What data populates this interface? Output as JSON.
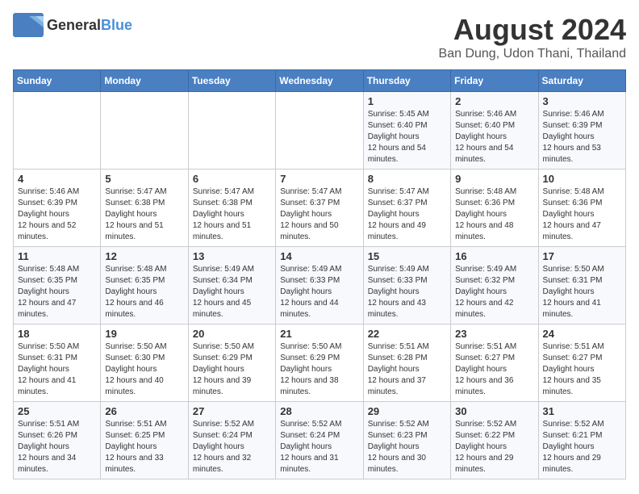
{
  "header": {
    "logo_general": "General",
    "logo_blue": "Blue",
    "month_year": "August 2024",
    "location": "Ban Dung, Udon Thani, Thailand"
  },
  "weekdays": [
    "Sunday",
    "Monday",
    "Tuesday",
    "Wednesday",
    "Thursday",
    "Friday",
    "Saturday"
  ],
  "weeks": [
    [
      {
        "day": "",
        "sunrise": "",
        "sunset": "",
        "daylight": ""
      },
      {
        "day": "",
        "sunrise": "",
        "sunset": "",
        "daylight": ""
      },
      {
        "day": "",
        "sunrise": "",
        "sunset": "",
        "daylight": ""
      },
      {
        "day": "",
        "sunrise": "",
        "sunset": "",
        "daylight": ""
      },
      {
        "day": "1",
        "sunrise": "5:45 AM",
        "sunset": "6:40 PM",
        "daylight": "12 hours and 54 minutes."
      },
      {
        "day": "2",
        "sunrise": "5:46 AM",
        "sunset": "6:40 PM",
        "daylight": "12 hours and 54 minutes."
      },
      {
        "day": "3",
        "sunrise": "5:46 AM",
        "sunset": "6:39 PM",
        "daylight": "12 hours and 53 minutes."
      }
    ],
    [
      {
        "day": "4",
        "sunrise": "5:46 AM",
        "sunset": "6:39 PM",
        "daylight": "12 hours and 52 minutes."
      },
      {
        "day": "5",
        "sunrise": "5:47 AM",
        "sunset": "6:38 PM",
        "daylight": "12 hours and 51 minutes."
      },
      {
        "day": "6",
        "sunrise": "5:47 AM",
        "sunset": "6:38 PM",
        "daylight": "12 hours and 51 minutes."
      },
      {
        "day": "7",
        "sunrise": "5:47 AM",
        "sunset": "6:37 PM",
        "daylight": "12 hours and 50 minutes."
      },
      {
        "day": "8",
        "sunrise": "5:47 AM",
        "sunset": "6:37 PM",
        "daylight": "12 hours and 49 minutes."
      },
      {
        "day": "9",
        "sunrise": "5:48 AM",
        "sunset": "6:36 PM",
        "daylight": "12 hours and 48 minutes."
      },
      {
        "day": "10",
        "sunrise": "5:48 AM",
        "sunset": "6:36 PM",
        "daylight": "12 hours and 47 minutes."
      }
    ],
    [
      {
        "day": "11",
        "sunrise": "5:48 AM",
        "sunset": "6:35 PM",
        "daylight": "12 hours and 47 minutes."
      },
      {
        "day": "12",
        "sunrise": "5:48 AM",
        "sunset": "6:35 PM",
        "daylight": "12 hours and 46 minutes."
      },
      {
        "day": "13",
        "sunrise": "5:49 AM",
        "sunset": "6:34 PM",
        "daylight": "12 hours and 45 minutes."
      },
      {
        "day": "14",
        "sunrise": "5:49 AM",
        "sunset": "6:33 PM",
        "daylight": "12 hours and 44 minutes."
      },
      {
        "day": "15",
        "sunrise": "5:49 AM",
        "sunset": "6:33 PM",
        "daylight": "12 hours and 43 minutes."
      },
      {
        "day": "16",
        "sunrise": "5:49 AM",
        "sunset": "6:32 PM",
        "daylight": "12 hours and 42 minutes."
      },
      {
        "day": "17",
        "sunrise": "5:50 AM",
        "sunset": "6:31 PM",
        "daylight": "12 hours and 41 minutes."
      }
    ],
    [
      {
        "day": "18",
        "sunrise": "5:50 AM",
        "sunset": "6:31 PM",
        "daylight": "12 hours and 41 minutes."
      },
      {
        "day": "19",
        "sunrise": "5:50 AM",
        "sunset": "6:30 PM",
        "daylight": "12 hours and 40 minutes."
      },
      {
        "day": "20",
        "sunrise": "5:50 AM",
        "sunset": "6:29 PM",
        "daylight": "12 hours and 39 minutes."
      },
      {
        "day": "21",
        "sunrise": "5:50 AM",
        "sunset": "6:29 PM",
        "daylight": "12 hours and 38 minutes."
      },
      {
        "day": "22",
        "sunrise": "5:51 AM",
        "sunset": "6:28 PM",
        "daylight": "12 hours and 37 minutes."
      },
      {
        "day": "23",
        "sunrise": "5:51 AM",
        "sunset": "6:27 PM",
        "daylight": "12 hours and 36 minutes."
      },
      {
        "day": "24",
        "sunrise": "5:51 AM",
        "sunset": "6:27 PM",
        "daylight": "12 hours and 35 minutes."
      }
    ],
    [
      {
        "day": "25",
        "sunrise": "5:51 AM",
        "sunset": "6:26 PM",
        "daylight": "12 hours and 34 minutes."
      },
      {
        "day": "26",
        "sunrise": "5:51 AM",
        "sunset": "6:25 PM",
        "daylight": "12 hours and 33 minutes."
      },
      {
        "day": "27",
        "sunrise": "5:52 AM",
        "sunset": "6:24 PM",
        "daylight": "12 hours and 32 minutes."
      },
      {
        "day": "28",
        "sunrise": "5:52 AM",
        "sunset": "6:24 PM",
        "daylight": "12 hours and 31 minutes."
      },
      {
        "day": "29",
        "sunrise": "5:52 AM",
        "sunset": "6:23 PM",
        "daylight": "12 hours and 30 minutes."
      },
      {
        "day": "30",
        "sunrise": "5:52 AM",
        "sunset": "6:22 PM",
        "daylight": "12 hours and 29 minutes."
      },
      {
        "day": "31",
        "sunrise": "5:52 AM",
        "sunset": "6:21 PM",
        "daylight": "12 hours and 29 minutes."
      }
    ]
  ]
}
